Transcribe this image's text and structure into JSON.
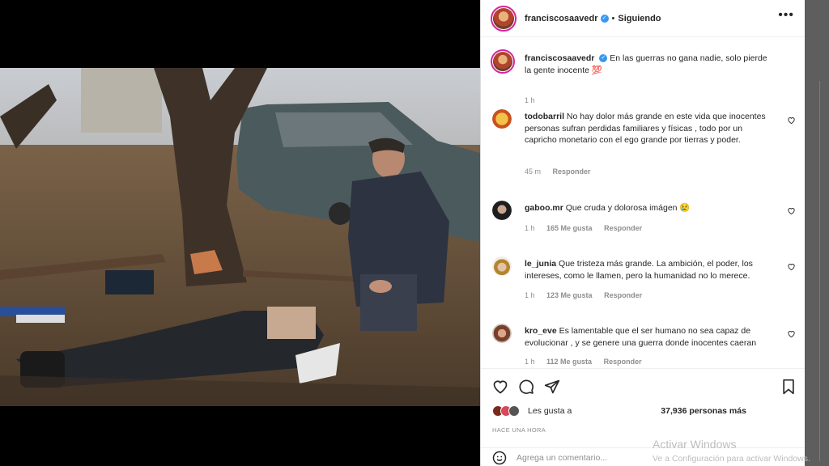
{
  "post": {
    "author": "franciscosaavedr",
    "follow_status": "Siguiendo",
    "separator": "•",
    "more_icon": "more-icon",
    "caption": "En las guerras no gana nadie, solo pierde la gente inocente 💯",
    "caption_time": "1 h"
  },
  "comments": [
    {
      "user": "todobarril",
      "text": "No hay dolor más grande en este vida que inocentes personas sufran perdidas familiares y físicas , todo por un capricho monetario con el ego grande por tierras y poder.",
      "time": "45 m",
      "likes": "",
      "reply": "Responder"
    },
    {
      "user": "gaboo.mr",
      "text": "Que cruda y dolorosa imágen 😢",
      "time": "1 h",
      "likes": "165 Me gusta",
      "reply": "Responder"
    },
    {
      "user": "le_junia",
      "text": "Que tristeza más grande. La ambición, el poder, los intereses, como le llamen, pero la humanidad no lo merece.",
      "time": "1 h",
      "likes": "123 Me gusta",
      "reply": "Responder"
    },
    {
      "user": "kro_eve",
      "text": "Es lamentable que el ser humano no sea capaz de evolucionar , y se genere una guerra donde inocentes caeran",
      "time": "1 h",
      "likes": "112 Me gusta",
      "reply": "Responder"
    }
  ],
  "likes": {
    "prefix": "Les gusta a",
    "count": "37,936 personas más"
  },
  "posted_ago": "HACE UNA HORA",
  "add_comment_placeholder": "Agrega un comentario...",
  "windows_watermark": {
    "title": "Activar Windows",
    "subtitle": "Ve a Configuración para activar Windows."
  },
  "colors": {
    "text": "#262626",
    "muted": "#8e8e8e",
    "verified": "#3897f0",
    "story_ring": "#d6249f"
  }
}
